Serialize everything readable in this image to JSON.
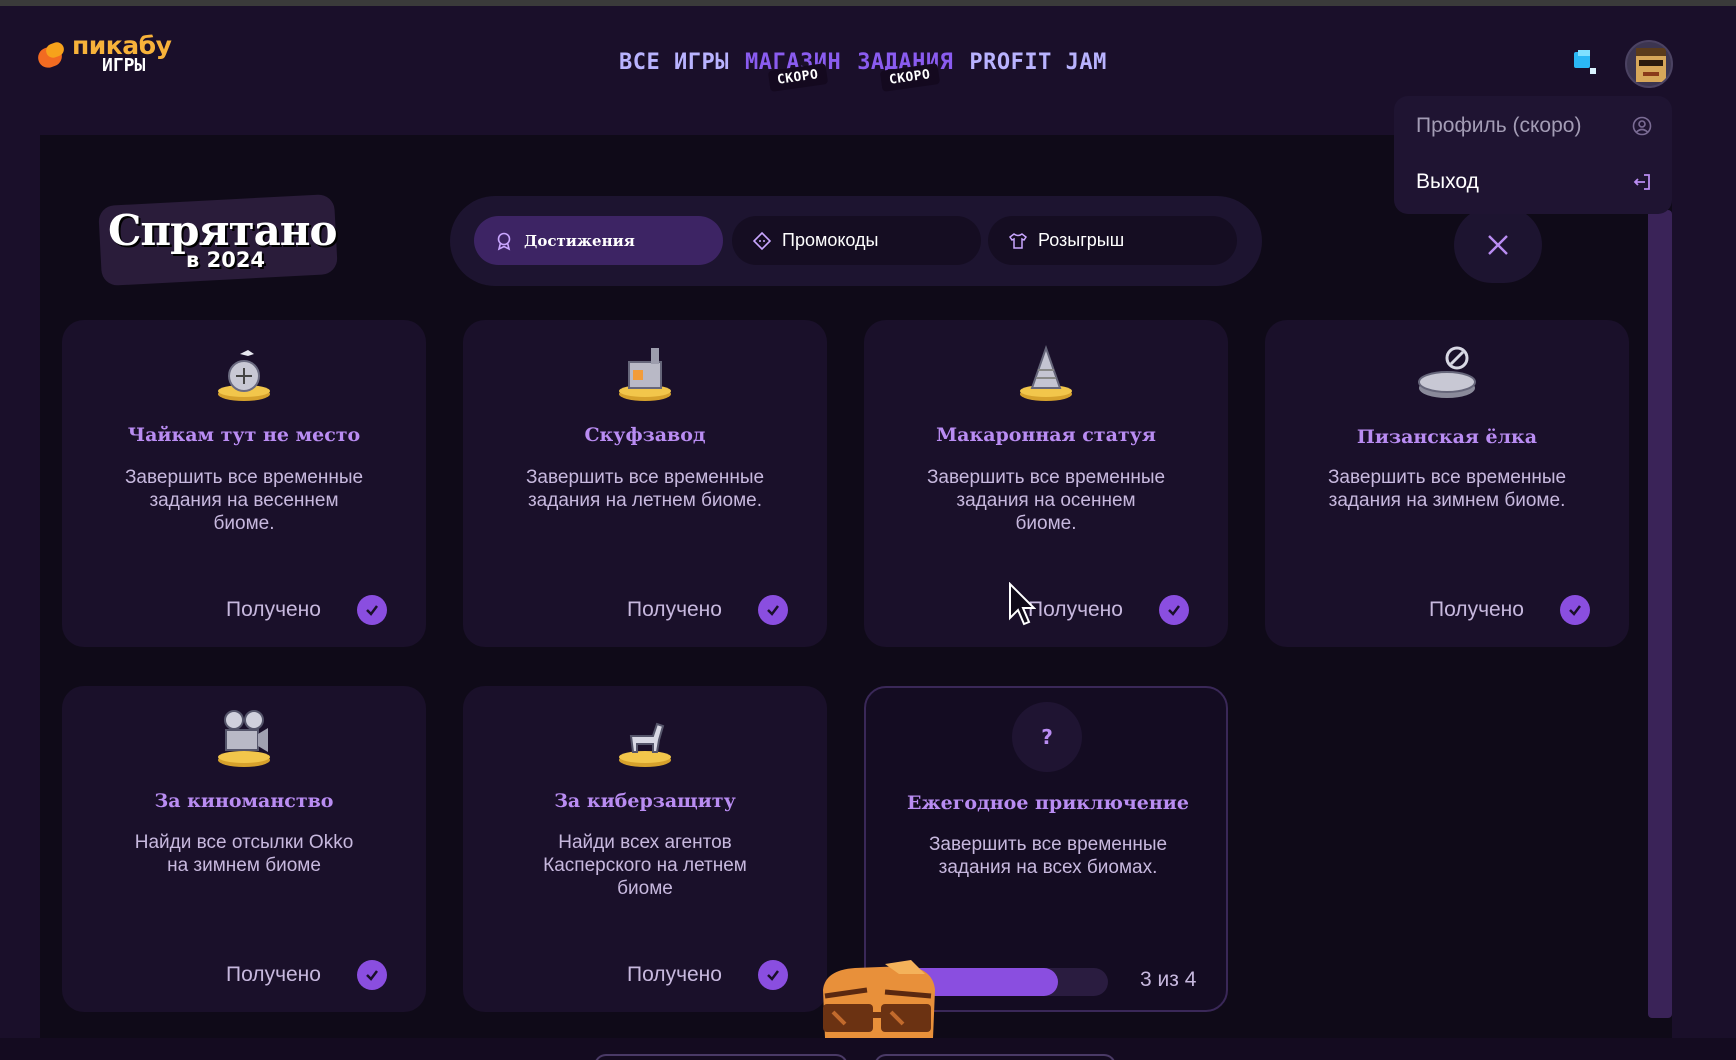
{
  "header": {
    "logo_top": "пикабу",
    "logo_bottom": "ИГРЫ",
    "nav": [
      {
        "label": "ВСЕ ИГРЫ",
        "soon": ""
      },
      {
        "label": "МАГАЗИН",
        "soon": "СКОРО"
      },
      {
        "label": "ЗАДАНИЯ",
        "soon": "СКОРО"
      },
      {
        "label": "PROFIT JAM",
        "soon": ""
      }
    ]
  },
  "user_menu": {
    "profile_label": "Профиль (скоро)",
    "logout_label": "Выход"
  },
  "game": {
    "logo_title": "Спрятано",
    "logo_subtitle": "в 2024"
  },
  "tabs": [
    {
      "label": "Достижения",
      "icon": "award-icon",
      "active": true
    },
    {
      "label": "Промокоды",
      "icon": "ticket-icon",
      "active": false
    },
    {
      "label": "Розыгрыш",
      "icon": "shirt-icon",
      "active": false
    }
  ],
  "achievements": [
    {
      "title": "Чайкам тут не место",
      "desc": "Завершить все временные задания на весеннем биоме.",
      "status": "Получено",
      "icon": "seagull-trophy-icon"
    },
    {
      "title": "Скуфзавод",
      "desc": "Завершить все временные задания на летнем биоме.",
      "status": "Получено",
      "icon": "factory-trophy-icon"
    },
    {
      "title": "Макаронная статуя",
      "desc": "Завершить все временные задания на осеннем биоме.",
      "status": "Получено",
      "icon": "statue-trophy-icon"
    },
    {
      "title": "Пизанская ёлка",
      "desc": "Завершить все временные задания на зимнем биоме.",
      "status": "Получено",
      "icon": "tree-trophy-icon"
    },
    {
      "title": "За киноманство",
      "desc": "Найди все отсылки Okko на зимнем биоме",
      "status": "Получено",
      "icon": "film-camera-trophy-icon"
    },
    {
      "title": "За киберзащиту",
      "desc": "Найди всех агентов Касперского на летнем биоме",
      "status": "Получено",
      "icon": "horse-trophy-icon"
    },
    {
      "title": "Ежегодное приключение",
      "desc": "Завершить все временные задания на всех биомах.",
      "progress_text": "3 из 4",
      "progress_value": 3,
      "progress_max": 4,
      "icon": "question-icon"
    }
  ],
  "colors": {
    "accent": "#8a4ee0",
    "title": "#b98cf2",
    "bg": "#0f0a18"
  }
}
